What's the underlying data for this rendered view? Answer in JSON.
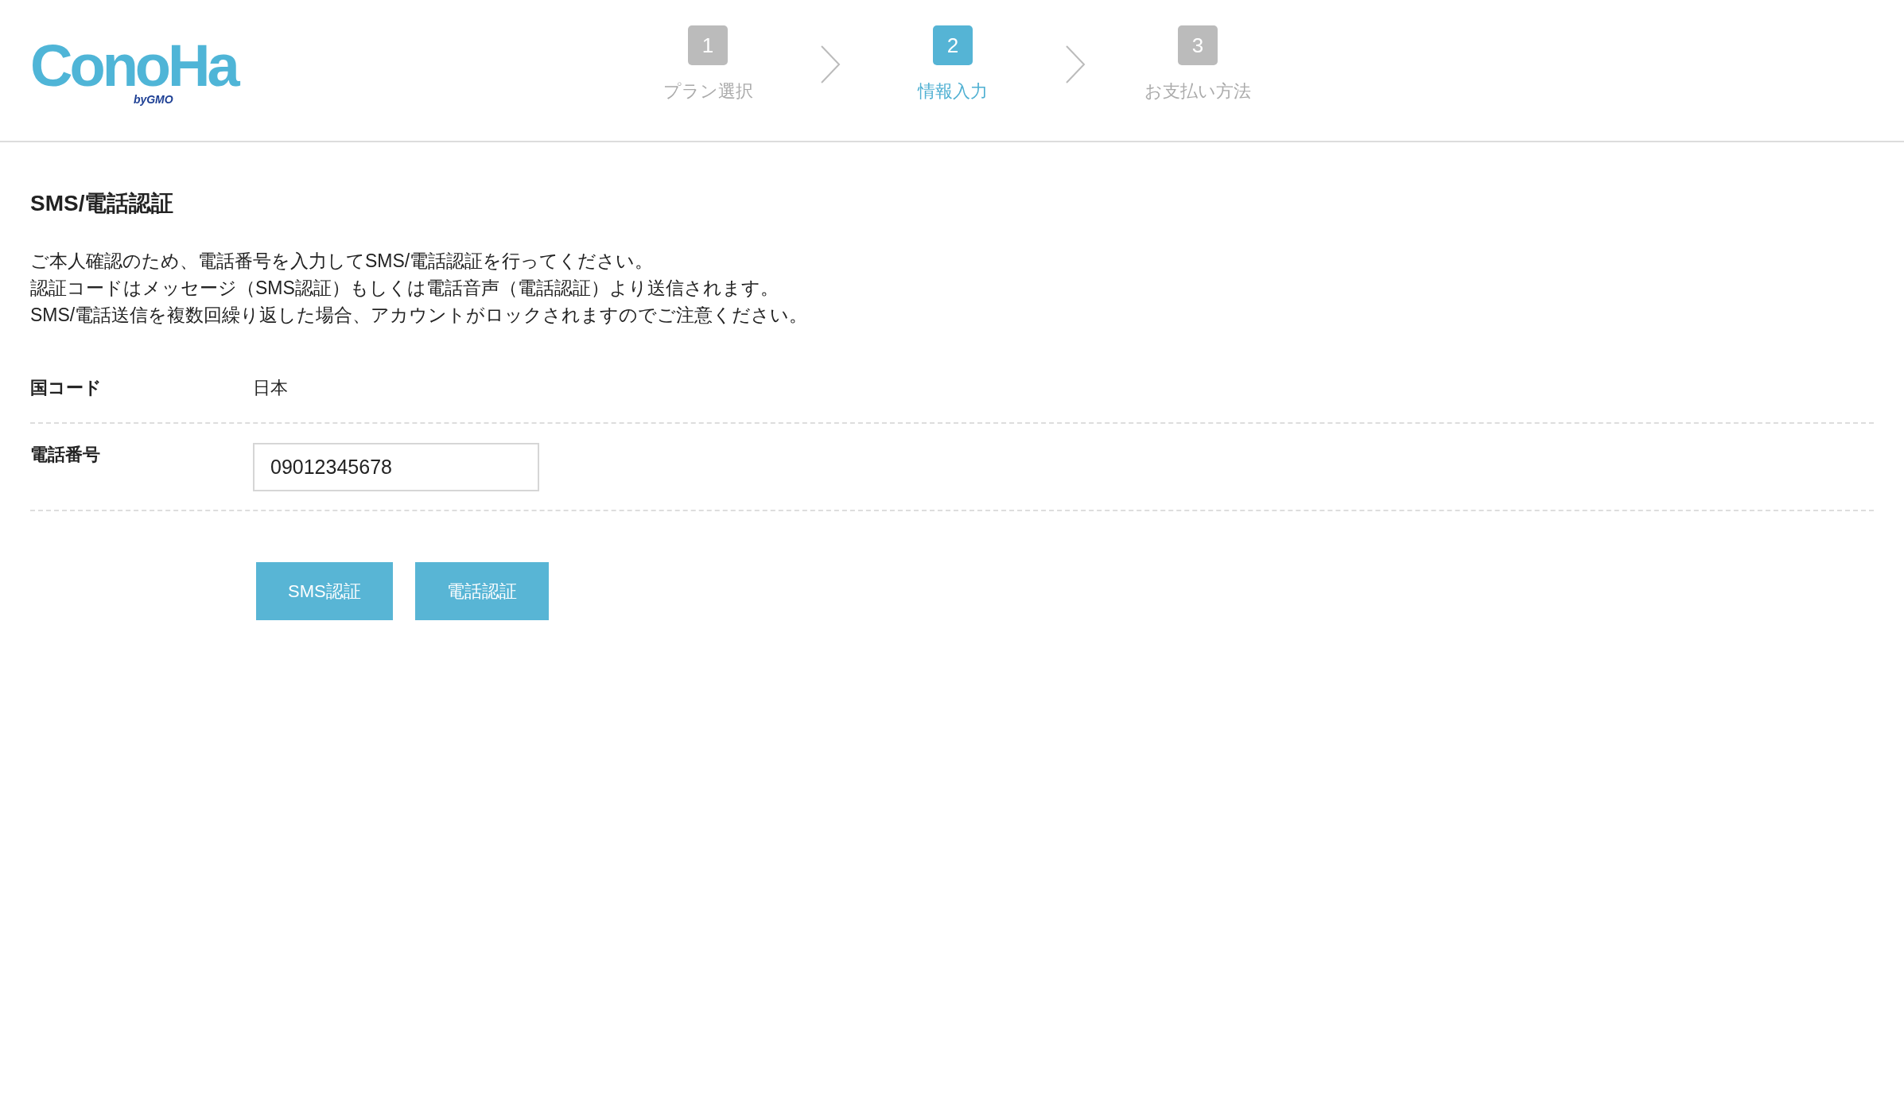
{
  "logo": {
    "text": "ConoHa",
    "sub": "byGMO"
  },
  "steps": [
    {
      "number": "1",
      "label": "プラン選択",
      "selected": false
    },
    {
      "number": "2",
      "label": "情報入力",
      "selected": true
    },
    {
      "number": "3",
      "label": "お支払い方法",
      "selected": false
    }
  ],
  "section": {
    "title": "SMS/電話認証",
    "description": [
      "ご本人確認のため、電話番号を入力してSMS/電話認証を行ってください。",
      "認証コードはメッセージ（SMS認証）もしくは電話音声（電話認証）より送信されます。",
      "SMS/電話送信を複数回繰り返した場合、アカウントがロックされますのでご注意ください。"
    ]
  },
  "form": [
    {
      "kind": "text",
      "label": "国コード",
      "value": "日本"
    },
    {
      "kind": "input",
      "label": "電話番号",
      "value": "09012345678"
    }
  ],
  "buttons": [
    "SMS認証",
    "電話認証"
  ]
}
